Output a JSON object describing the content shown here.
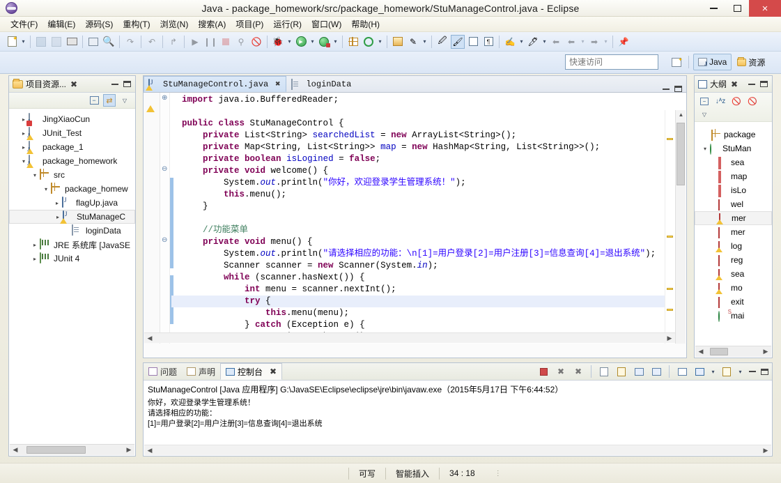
{
  "window": {
    "title": "Java  -  package_homework/src/package_homework/StuManageControl.java  -  Eclipse",
    "logo_name": "eclipse-logo",
    "minimize": "–",
    "maximize": "□",
    "close": "×"
  },
  "menubar": {
    "items": [
      {
        "label": "文件(F)"
      },
      {
        "label": "编辑(E)"
      },
      {
        "label": "源码(S)"
      },
      {
        "label": "重构(T)"
      },
      {
        "label": "浏览(N)"
      },
      {
        "label": "搜索(A)"
      },
      {
        "label": "项目(P)"
      },
      {
        "label": "运行(R)"
      },
      {
        "label": "窗口(W)"
      },
      {
        "label": "帮助(H)"
      }
    ]
  },
  "quick_access": {
    "placeholder": "快速访问",
    "value": ""
  },
  "perspectives": {
    "open_label": "",
    "items": [
      {
        "label": "Java",
        "active": true
      },
      {
        "label": "资源",
        "active": false
      }
    ]
  },
  "project_explorer": {
    "title": "项目资源...",
    "close": "✖",
    "tree": [
      {
        "label": "JingXiaoCun",
        "indent": 0,
        "twist": "▸",
        "icon": "java-project-error-icon"
      },
      {
        "label": "JUnit_Test",
        "indent": 0,
        "twist": "▸",
        "icon": "java-project-icon"
      },
      {
        "label": "package_1",
        "indent": 0,
        "twist": "▸",
        "icon": "java-project-icon"
      },
      {
        "label": "package_homework",
        "indent": 0,
        "twist": "▾",
        "icon": "java-project-icon"
      },
      {
        "label": "src",
        "indent": 1,
        "twist": "▾",
        "icon": "source-folder-icon"
      },
      {
        "label": "package_homew",
        "indent": 2,
        "twist": "▾",
        "icon": "package-icon"
      },
      {
        "label": "flagUp.java",
        "indent": 3,
        "twist": "▸",
        "icon": "java-file-icon"
      },
      {
        "label": "StuManageC",
        "indent": 3,
        "twist": "▸",
        "icon": "java-file-warning-icon",
        "selected": true
      },
      {
        "label": "loginData",
        "indent": 3,
        "twist": "",
        "icon": "text-file-icon"
      },
      {
        "label": "JRE 系统库 [JavaSE",
        "indent": 1,
        "twist": "▸",
        "icon": "library-icon"
      },
      {
        "label": "JUnit 4",
        "indent": 1,
        "twist": "▸",
        "icon": "library-icon"
      }
    ]
  },
  "editor": {
    "tabs": [
      {
        "label": "StuManageControl.java",
        "icon": "java-file-warning-icon",
        "active": true,
        "close": "✖"
      },
      {
        "label": "loginData",
        "icon": "text-file-icon",
        "active": false,
        "close": ""
      }
    ],
    "code_lines": [
      {
        "fold": "⊕",
        "tokens": [
          {
            "t": "  ",
            "c": ""
          },
          {
            "t": "import",
            "c": "kw"
          },
          {
            "t": " java.io.BufferedReader;",
            "c": ""
          }
        ]
      },
      {
        "fold": "",
        "tokens": [
          {
            "t": "",
            "c": ""
          }
        ]
      },
      {
        "fold": "",
        "tokens": [
          {
            "t": "  ",
            "c": ""
          },
          {
            "t": "public class",
            "c": "kw"
          },
          {
            "t": " StuManageControl {",
            "c": ""
          }
        ]
      },
      {
        "fold": "",
        "tokens": [
          {
            "t": "      ",
            "c": ""
          },
          {
            "t": "private",
            "c": "kw"
          },
          {
            "t": " List<String> ",
            "c": ""
          },
          {
            "t": "searchedList",
            "c": "fld"
          },
          {
            "t": " = ",
            "c": ""
          },
          {
            "t": "new",
            "c": "kw"
          },
          {
            "t": " ArrayList<String>();",
            "c": ""
          }
        ]
      },
      {
        "fold": "",
        "tokens": [
          {
            "t": "      ",
            "c": ""
          },
          {
            "t": "private",
            "c": "kw"
          },
          {
            "t": " Map<String, List<String>> ",
            "c": ""
          },
          {
            "t": "map",
            "c": "fld"
          },
          {
            "t": " = ",
            "c": ""
          },
          {
            "t": "new",
            "c": "kw"
          },
          {
            "t": " HashMap<String, List<String>>();",
            "c": ""
          }
        ]
      },
      {
        "fold": "",
        "tokens": [
          {
            "t": "      ",
            "c": ""
          },
          {
            "t": "private boolean",
            "c": "kw"
          },
          {
            "t": " ",
            "c": ""
          },
          {
            "t": "isLogined",
            "c": "fld"
          },
          {
            "t": " = ",
            "c": ""
          },
          {
            "t": "false",
            "c": "kw"
          },
          {
            "t": ";",
            "c": ""
          }
        ]
      },
      {
        "fold": "⊖",
        "tokens": [
          {
            "t": "      ",
            "c": ""
          },
          {
            "t": "private void",
            "c": "kw"
          },
          {
            "t": " welcome() {",
            "c": ""
          }
        ]
      },
      {
        "fold": "",
        "tokens": [
          {
            "t": "          System.",
            "c": ""
          },
          {
            "t": "out",
            "c": "fld stat"
          },
          {
            "t": ".println(",
            "c": ""
          },
          {
            "t": "\"你好，欢迎登录学生管理系统！\"",
            "c": "str"
          },
          {
            "t": ");",
            "c": ""
          }
        ]
      },
      {
        "fold": "",
        "tokens": [
          {
            "t": "          ",
            "c": ""
          },
          {
            "t": "this",
            "c": "kw"
          },
          {
            "t": ".menu();",
            "c": ""
          }
        ]
      },
      {
        "fold": "",
        "tokens": [
          {
            "t": "      }",
            "c": ""
          }
        ]
      },
      {
        "fold": "",
        "tokens": [
          {
            "t": "",
            "c": ""
          }
        ]
      },
      {
        "fold": "",
        "tokens": [
          {
            "t": "      ",
            "c": ""
          },
          {
            "t": "//功能菜单",
            "c": "cmt"
          }
        ]
      },
      {
        "fold": "⊖",
        "tokens": [
          {
            "t": "      ",
            "c": ""
          },
          {
            "t": "private void",
            "c": "kw"
          },
          {
            "t": " menu() {",
            "c": ""
          }
        ]
      },
      {
        "fold": "",
        "tokens": [
          {
            "t": "          System.",
            "c": ""
          },
          {
            "t": "out",
            "c": "fld stat"
          },
          {
            "t": ".println(",
            "c": ""
          },
          {
            "t": "\"请选择相应的功能：\\n[1]=用户登录[2]=用户注册[3]=信息查询[4]=退出系统\"",
            "c": "str"
          },
          {
            "t": ");",
            "c": ""
          }
        ]
      },
      {
        "fold": "",
        "tokens": [
          {
            "t": "          Scanner scanner = ",
            "c": ""
          },
          {
            "t": "new",
            "c": "kw"
          },
          {
            "t": " Scanner(System.",
            "c": ""
          },
          {
            "t": "in",
            "c": "fld stat"
          },
          {
            "t": ");",
            "c": ""
          }
        ]
      },
      {
        "fold": "",
        "tokens": [
          {
            "t": "          ",
            "c": ""
          },
          {
            "t": "while",
            "c": "kw"
          },
          {
            "t": " (scanner.hasNext()) {",
            "c": ""
          }
        ]
      },
      {
        "fold": "",
        "tokens": [
          {
            "t": "              ",
            "c": ""
          },
          {
            "t": "int",
            "c": "kw"
          },
          {
            "t": " menu = scanner.nextInt();",
            "c": ""
          }
        ]
      },
      {
        "fold": "",
        "highlight": true,
        "tokens": [
          {
            "t": "              ",
            "c": ""
          },
          {
            "t": "try",
            "c": "kw"
          },
          {
            "t": " {",
            "c": ""
          }
        ]
      },
      {
        "fold": "",
        "tokens": [
          {
            "t": "                  ",
            "c": ""
          },
          {
            "t": "this",
            "c": "kw"
          },
          {
            "t": ".menu(menu);",
            "c": ""
          }
        ]
      },
      {
        "fold": "",
        "tokens": [
          {
            "t": "              } ",
            "c": ""
          },
          {
            "t": "catch",
            "c": "kw"
          },
          {
            "t": " (Exception e) {",
            "c": ""
          }
        ]
      },
      {
        "fold": "",
        "tokens": [
          {
            "t": "                  e.printStackTrace();",
            "c": ""
          }
        ]
      },
      {
        "fold": "",
        "tokens": [
          {
            "t": "              }",
            "c": ""
          }
        ]
      },
      {
        "fold": "",
        "tokens": [
          {
            "t": "          }",
            "c": ""
          }
        ]
      }
    ]
  },
  "outline": {
    "title": "大纲",
    "close": "✖",
    "items": [
      {
        "label": "package",
        "icon": "package-icon",
        "indent": 1,
        "twist": ""
      },
      {
        "label": "StuMan",
        "icon": "class-icon",
        "indent": 0,
        "twist": "▾"
      },
      {
        "label": "sea",
        "icon": "field-icon",
        "indent": 2,
        "twist": ""
      },
      {
        "label": "map",
        "icon": "field-icon",
        "indent": 2,
        "twist": ""
      },
      {
        "label": "isLo",
        "icon": "field-icon",
        "indent": 2,
        "twist": ""
      },
      {
        "label": "wel",
        "icon": "method-icon",
        "indent": 2,
        "twist": ""
      },
      {
        "label": "mer",
        "icon": "method-warning-icon",
        "indent": 2,
        "twist": "",
        "selected": true
      },
      {
        "label": "mer",
        "icon": "method-icon",
        "indent": 2,
        "twist": ""
      },
      {
        "label": "log",
        "icon": "method-warning-icon",
        "indent": 2,
        "twist": ""
      },
      {
        "label": "reg",
        "icon": "method-icon",
        "indent": 2,
        "twist": ""
      },
      {
        "label": "sea",
        "icon": "method-warning-icon",
        "indent": 2,
        "twist": ""
      },
      {
        "label": "mo",
        "icon": "method-warning-icon",
        "indent": 2,
        "twist": ""
      },
      {
        "label": "exit",
        "icon": "method-icon",
        "indent": 2,
        "twist": ""
      },
      {
        "label": "mai",
        "icon": "main-method-icon",
        "indent": 2,
        "twist": ""
      }
    ]
  },
  "console": {
    "tabs": [
      {
        "label": "问题",
        "icon": "problems-icon",
        "active": false,
        "close": ""
      },
      {
        "label": "声明",
        "icon": "declaration-icon",
        "active": false,
        "close": ""
      },
      {
        "label": "控制台",
        "icon": "console-icon",
        "active": true,
        "close": "✖"
      }
    ],
    "launch_header": "StuManageControl [Java 应用程序] G:\\JavaSE\\Eclipse\\eclipse\\jre\\bin\\javaw.exe（2015年5月17日 下午6:44:52）",
    "output_lines": [
      "你好，欢迎登录学生管理系统！",
      "请选择相应的功能：",
      "[1]=用户登录[2]=用户注册[3]=信息查询[4]=退出系统"
    ]
  },
  "statusbar": {
    "writable": "可写",
    "insert_mode": "智能插入",
    "cursor_position": "34 : 18"
  },
  "colors": {
    "accent": "#cfe0f4",
    "keyword": "#7f0055",
    "string": "#2a00ff",
    "comment": "#3f7f5f",
    "field": "#0000c0",
    "close_red": "#d44a4a"
  }
}
